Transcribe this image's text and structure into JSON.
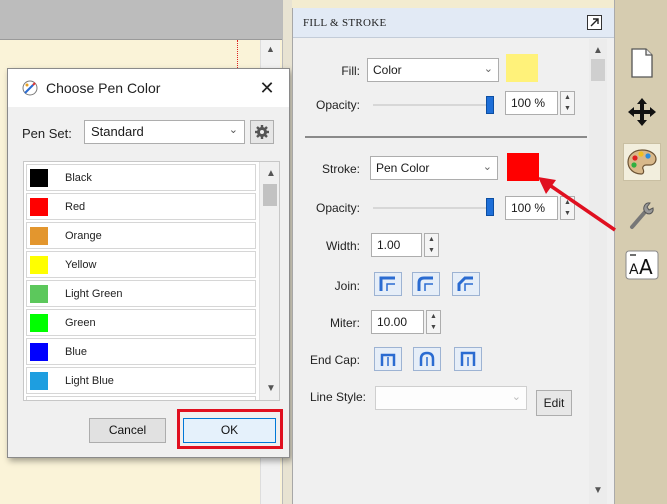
{
  "dialog": {
    "title": "Choose Pen Color",
    "close_glyph": "✕",
    "pen_set_label": "Pen Set:",
    "pen_set_value": "Standard",
    "colors": [
      {
        "name": "Black",
        "hex": "#000000"
      },
      {
        "name": "Red",
        "hex": "#ff0000"
      },
      {
        "name": "Orange",
        "hex": "#e3962e"
      },
      {
        "name": "Yellow",
        "hex": "#ffff00"
      },
      {
        "name": "Light Green",
        "hex": "#5cc85c"
      },
      {
        "name": "Green",
        "hex": "#00ff00"
      },
      {
        "name": "Blue",
        "hex": "#0000ff"
      },
      {
        "name": "Light Blue",
        "hex": "#1e9ee0"
      },
      {
        "name": "",
        "hex": "#9b30c8"
      }
    ],
    "cancel_label": "Cancel",
    "ok_label": "OK"
  },
  "panel": {
    "title": "FILL & STROKE",
    "fill_label": "Fill:",
    "fill_value": "Color",
    "fill_color": "#fff27a",
    "fill_opacity_label": "Opacity:",
    "fill_opacity_value": "100 %",
    "fill_opacity_fraction": 1.0,
    "stroke_label": "Stroke:",
    "stroke_value": "Pen Color",
    "stroke_color": "#ff0000",
    "stroke_opacity_label": "Opacity:",
    "stroke_opacity_value": "100 %",
    "stroke_opacity_fraction": 1.0,
    "width_label": "Width:",
    "width_value": "1.00",
    "join_label": "Join:",
    "miter_label": "Miter:",
    "miter_value": "10.00",
    "endcap_label": "End Cap:",
    "linestyle_label": "Line Style:",
    "linestyle_value": "",
    "edit_label": "Edit"
  },
  "tools": [
    "page-icon",
    "move-icon",
    "palette-icon",
    "wrench-icon",
    "text-size-icon"
  ],
  "annotation_color": "#e01020"
}
